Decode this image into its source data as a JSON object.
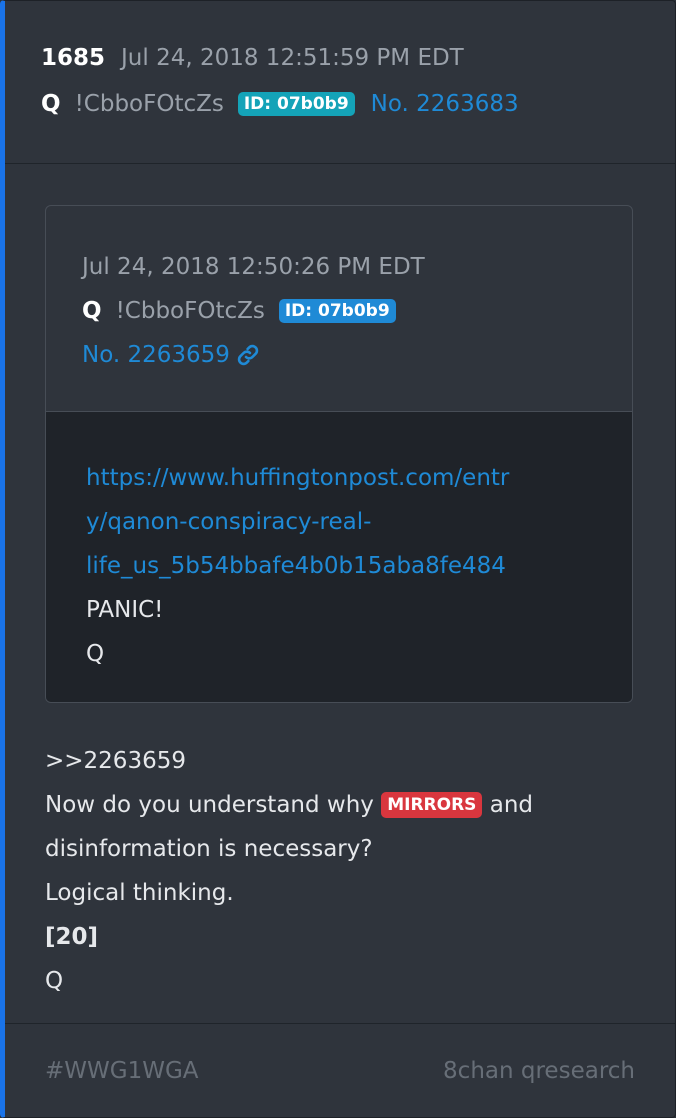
{
  "post": {
    "number": "1685",
    "datetime": "Jul 24, 2018 12:51:59 PM EDT",
    "author": "Q",
    "tripcode": "!CbboFOtcZs",
    "id_badge": "ID: 07b0b9",
    "post_no": "No. 2263683"
  },
  "quoted": {
    "datetime": "Jul 24, 2018 12:50:26 PM EDT",
    "author": "Q",
    "tripcode": "!CbboFOtcZs",
    "id_badge": "ID: 07b0b9",
    "post_no": "No. 2263659",
    "link_icon": "link-icon",
    "url_lines": [
      "https://www.huffingtonpost.com/entr",
      "y/qanon-conspiracy-real-",
      "life_us_5b54bbafe4b0b15aba8fe484"
    ],
    "text_lines": [
      "PANIC!",
      "Q"
    ]
  },
  "body": {
    "reply_ref": ">>2263659",
    "line1_before": "Now do you understand why",
    "badge": "MIRRORS",
    "line1_after": "and",
    "line2": "disinformation is necessary?",
    "line3": "Logical thinking.",
    "line4": "[20]",
    "signature": "Q"
  },
  "footer": {
    "hashtag": "#WWG1WGA",
    "source": "8chan qresearch"
  },
  "colors": {
    "accent_border": "#1a73e8",
    "link": "#1f8ad6",
    "id_badge_main": "#14a3b8",
    "id_badge_quote": "#1f8ad6",
    "mirrors_badge": "#d9363e"
  }
}
